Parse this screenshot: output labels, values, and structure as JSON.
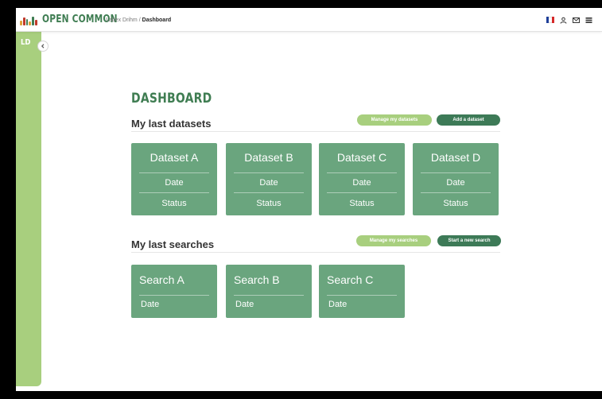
{
  "app": {
    "name": "OPEN COMMON",
    "colors": {
      "primary_green": "#3f7d52",
      "card_green": "#6aa57e",
      "light_green": "#a8cf7e",
      "dark_button": "#3d7a57"
    }
  },
  "breadcrumb": {
    "parent": "Labex Drihm",
    "separator": "/",
    "current": "Dashboard"
  },
  "topbar_icons": [
    "france-flag-icon",
    "user-icon",
    "mail-icon",
    "menu-icon"
  ],
  "sidebar": {
    "initials": "LD",
    "toggle_icon": "chevron-left-icon"
  },
  "page": {
    "title": "DASHBOARD"
  },
  "datasets": {
    "heading": "My last datasets",
    "manage_label": "Manage  my datasets",
    "add_label": "Add a dataset",
    "cards": [
      {
        "title": "Dataset A",
        "date": "Date",
        "status": "Status"
      },
      {
        "title": "Dataset B",
        "date": "Date",
        "status": "Status"
      },
      {
        "title": "Dataset C",
        "date": "Date",
        "status": "Status"
      },
      {
        "title": "Dataset D",
        "date": "Date",
        "status": "Status"
      }
    ]
  },
  "searches": {
    "heading": "My last searches",
    "manage_label": "Manage my searches",
    "new_label": "Start a new search",
    "cards": [
      {
        "title": "Search A",
        "date": "Date"
      },
      {
        "title": "Search B",
        "date": "Date"
      },
      {
        "title": "Search C",
        "date": "Date"
      }
    ]
  }
}
